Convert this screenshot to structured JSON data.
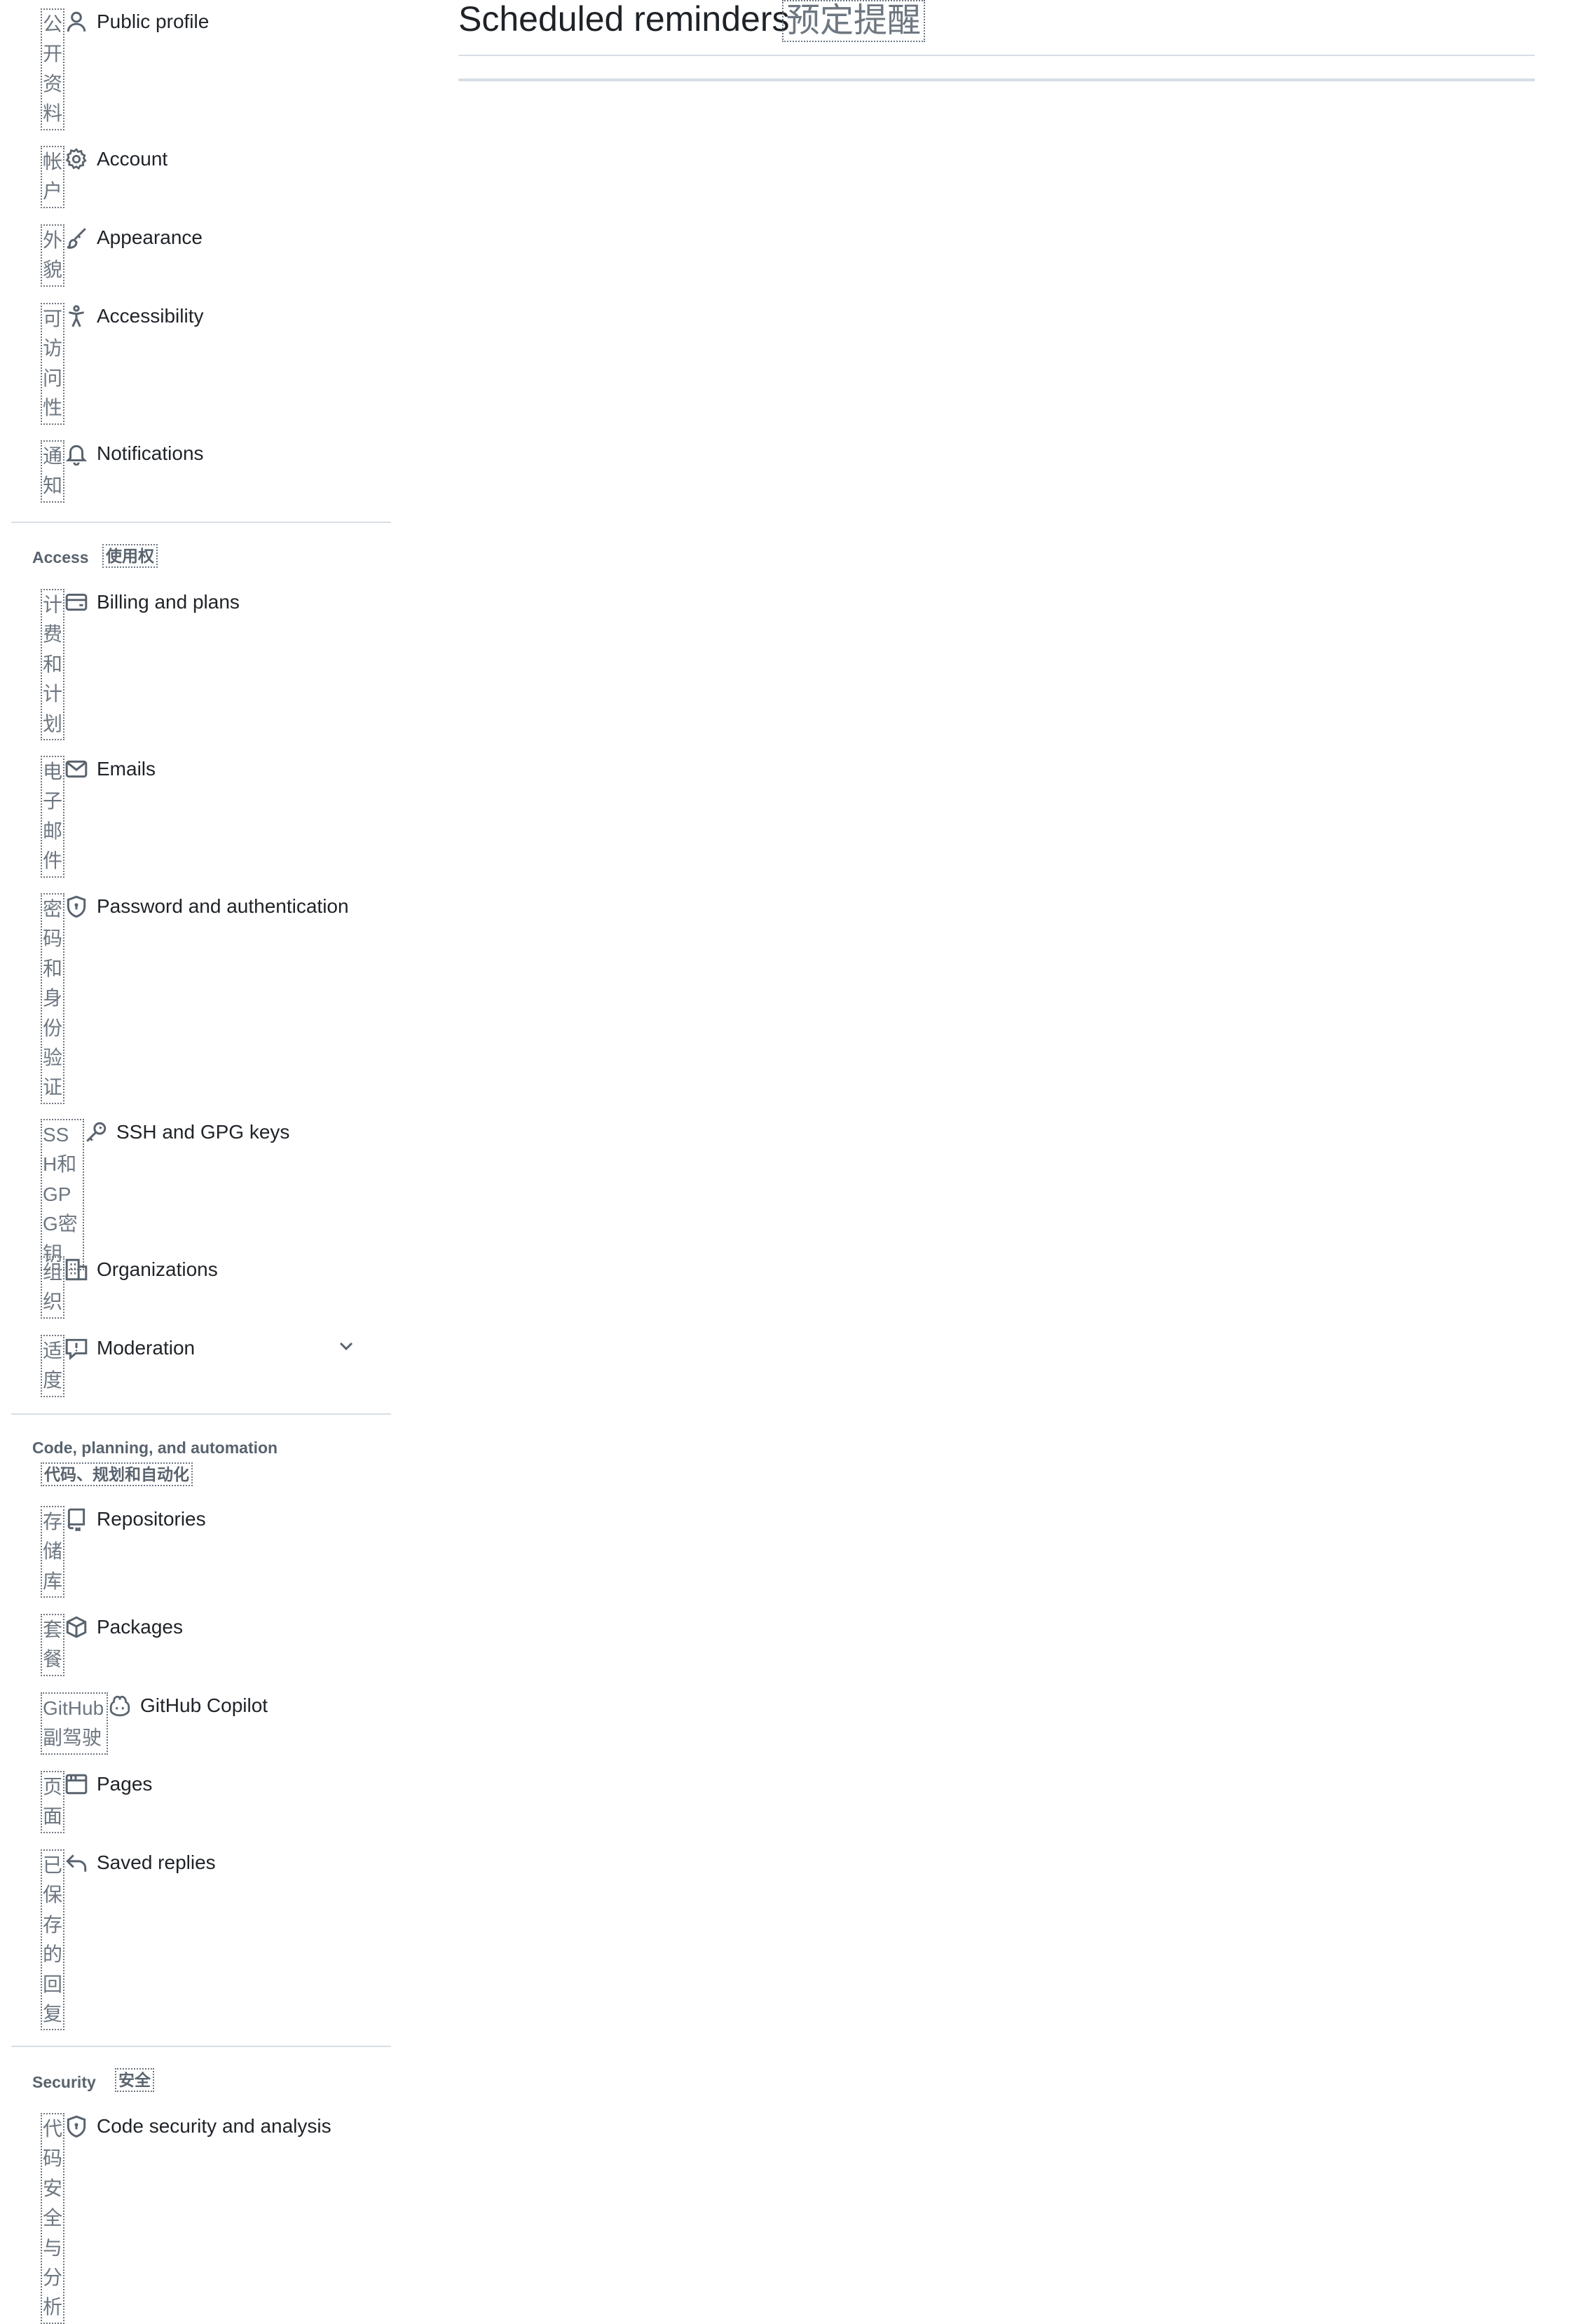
{
  "main": {
    "title": "Scheduled reminders",
    "title_translation": "预定提醒"
  },
  "sidebar": {
    "items": [
      {
        "label": "Public profile",
        "translation": "公开资料",
        "icon": "person-icon"
      },
      {
        "label": "Account",
        "translation": "帐户",
        "icon": "gear-icon"
      },
      {
        "label": "Appearance",
        "translation": "外貌",
        "icon": "paintbrush-icon"
      },
      {
        "label": "Accessibility",
        "translation": "可访问性",
        "icon": "accessibility-icon"
      },
      {
        "label": "Notifications",
        "translation": "通知",
        "icon": "bell-icon"
      }
    ],
    "sections": [
      {
        "header": "Access",
        "header_translation": "使用权",
        "items": [
          {
            "label": "Billing and plans",
            "translation": "计费和计划",
            "icon": "credit-card-icon"
          },
          {
            "label": "Emails",
            "translation": "电子邮件",
            "icon": "mail-icon"
          },
          {
            "label": "Password and authentication",
            "translation": "密码和身份验证",
            "icon": "shield-lock-icon"
          },
          {
            "label": "SSH and GPG keys",
            "translation": "SSH和GPG密钥",
            "icon": "key-icon"
          },
          {
            "label": "Organizations",
            "translation": "组织",
            "icon": "organization-icon"
          },
          {
            "label": "Moderation",
            "translation": "适度",
            "icon": "report-icon",
            "chevron": "chevron-down-icon"
          }
        ]
      },
      {
        "header": "Code, planning, and automation",
        "header_translation": "代码、规划和自动化",
        "items": [
          {
            "label": "Repositories",
            "translation": "存储库",
            "icon": "repo-icon"
          },
          {
            "label": "Packages",
            "translation": "套餐",
            "icon": "package-icon"
          },
          {
            "label": "GitHub Copilot",
            "translation": "GitHub副驾驶",
            "icon": "copilot-icon"
          },
          {
            "label": "Pages",
            "translation": "页面",
            "icon": "browser-icon"
          },
          {
            "label": "Saved replies",
            "translation": "已保存的回复",
            "icon": "reply-icon"
          }
        ]
      },
      {
        "header": "Security",
        "header_translation": "安全",
        "items": [
          {
            "label": "Code security and analysis",
            "translation": "代码安全与分析",
            "icon": "shield-lock-icon"
          }
        ]
      }
    ]
  },
  "colors": {
    "text": "#1f2328",
    "muted": "#6e7781",
    "border": "#d8dee4",
    "header": "#59636e"
  }
}
